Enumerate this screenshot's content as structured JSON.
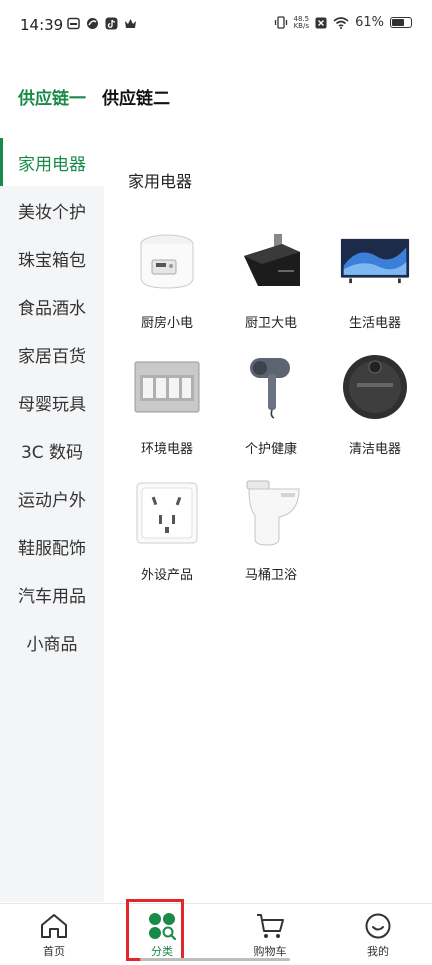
{
  "status_bar": {
    "time": "14:39",
    "net_speed_value": "48.5",
    "net_speed_unit": "KB/s",
    "battery": "61%"
  },
  "top_tabs": [
    {
      "label": "供应链一",
      "active": true
    },
    {
      "label": "供应链二",
      "active": false
    }
  ],
  "sidebar": {
    "items": [
      {
        "label": "家用电器",
        "active": true
      },
      {
        "label": "美妆个护"
      },
      {
        "label": "珠宝箱包"
      },
      {
        "label": "食品酒水"
      },
      {
        "label": "家居百货"
      },
      {
        "label": "母婴玩具"
      },
      {
        "label": "3C 数码"
      },
      {
        "label": "运动户外"
      },
      {
        "label": "鞋服配饰"
      },
      {
        "label": "汽车用品"
      },
      {
        "label": "小商品"
      }
    ]
  },
  "content": {
    "section_title": "家用电器",
    "categories": [
      {
        "label": "厨房小电",
        "icon": "rice-cooker-icon"
      },
      {
        "label": "厨卫大电",
        "icon": "range-hood-icon"
      },
      {
        "label": "生活电器",
        "icon": "tv-icon"
      },
      {
        "label": "环境电器",
        "icon": "switch-panel-icon"
      },
      {
        "label": "个护健康",
        "icon": "hair-dryer-icon"
      },
      {
        "label": "清洁电器",
        "icon": "robot-vacuum-icon"
      },
      {
        "label": "外设产品",
        "icon": "wall-socket-icon"
      },
      {
        "label": "马桶卫浴",
        "icon": "toilet-icon"
      }
    ]
  },
  "bottom_nav": [
    {
      "label": "首页",
      "icon": "home-icon"
    },
    {
      "label": "分类",
      "icon": "category-icon",
      "active": true
    },
    {
      "label": "购物车",
      "icon": "cart-icon"
    },
    {
      "label": "我的",
      "icon": "profile-icon"
    }
  ],
  "colors": {
    "accent": "#1a8a4a",
    "highlight": "#e3262a",
    "sidebar_bg": "#f4f5f7"
  }
}
